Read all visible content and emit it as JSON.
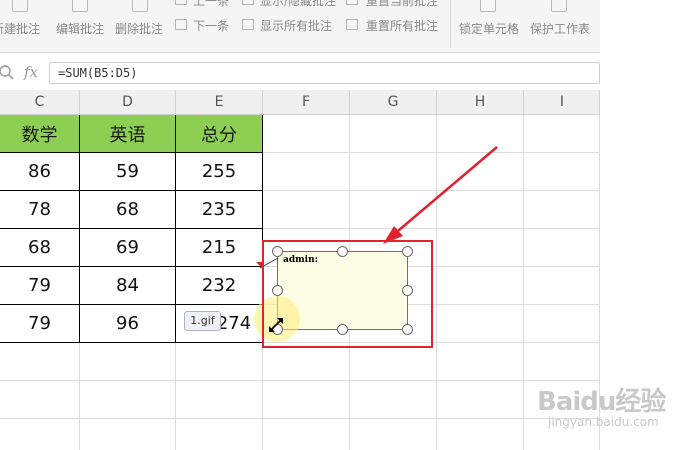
{
  "ribbon": {
    "buttons": [
      {
        "label": "新建批注",
        "icon": "new-comment-icon"
      },
      {
        "label": "编辑批注",
        "icon": "edit-comment-icon"
      },
      {
        "label": "删除批注",
        "icon": "delete-comment-icon"
      }
    ],
    "nav_top": "上一条",
    "nav_bottom": "下一条",
    "show_top": "显示/隐藏批注",
    "show_bottom": "显示所有批注",
    "reset_top": "重置当前批注",
    "reset_bottom": "重置所有批注",
    "lock_cell": "锁定单元格",
    "protect_sheet": "保护工作表"
  },
  "formula_bar": {
    "fx_label": "fx",
    "formula": "=SUM(B5:D5)"
  },
  "columns": [
    "C",
    "D",
    "E",
    "F",
    "G",
    "H",
    "I"
  ],
  "table": {
    "headers": [
      "数学",
      "英语",
      "总分"
    ],
    "rows": [
      [
        "86",
        "59",
        "255"
      ],
      [
        "78",
        "68",
        "235"
      ],
      [
        "68",
        "69",
        "215"
      ],
      [
        "79",
        "84",
        "232"
      ],
      [
        "79",
        "96",
        "274"
      ]
    ],
    "header_color": "#8ccf52"
  },
  "comment": {
    "author": "admin:",
    "box_color": "#fdfde6",
    "frame_color": "#e0232e"
  },
  "tooltip": "1.gif",
  "watermark": {
    "brand": "Baidu经验",
    "site": "jingyan.baidu.com"
  }
}
